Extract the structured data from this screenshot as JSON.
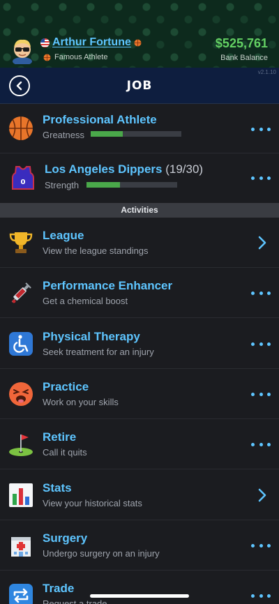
{
  "player": {
    "name": "Arthur Fortune",
    "title": "Famous Athlete",
    "bank_balance": "$525,761",
    "bank_label": "Bank Balance",
    "version": "v2.1.10"
  },
  "nav": {
    "title": "JOB"
  },
  "job": {
    "title": "Professional Athlete",
    "stat_label": "Greatness",
    "stat_progress": 0.35
  },
  "team": {
    "name": "Los Angeles Dippers",
    "count": "(19/30)",
    "stat_label": "Strength",
    "stat_progress": 0.37,
    "jersey_number": "0"
  },
  "section": {
    "label": "Activities"
  },
  "activities": [
    {
      "title": "League",
      "subtitle": "View the league standings",
      "icon": "trophy-icon",
      "action": "chevron"
    },
    {
      "title": "Performance Enhancer",
      "subtitle": "Get a chemical boost",
      "icon": "syringe-icon",
      "action": "more"
    },
    {
      "title": "Physical Therapy",
      "subtitle": "Seek treatment for an injury",
      "icon": "wheelchair-icon",
      "action": "more"
    },
    {
      "title": "Practice",
      "subtitle": "Work on your skills",
      "icon": "tired-face-icon",
      "action": "more"
    },
    {
      "title": "Retire",
      "subtitle": "Call it quits",
      "icon": "golf-flag-icon",
      "action": "more"
    },
    {
      "title": "Stats",
      "subtitle": "View your historical stats",
      "icon": "bar-chart-icon",
      "action": "chevron"
    },
    {
      "title": "Surgery",
      "subtitle": "Undergo surgery on an injury",
      "icon": "hospital-icon",
      "action": "more"
    },
    {
      "title": "Trade",
      "subtitle": "Request a trade",
      "icon": "repeat-icon",
      "action": "more"
    }
  ],
  "colors": {
    "accent": "#5ec5ff",
    "money": "#63d063",
    "progress": "#4aa84a",
    "nav_bg": "#0e1e3f",
    "row_bg": "#1b1c20"
  }
}
